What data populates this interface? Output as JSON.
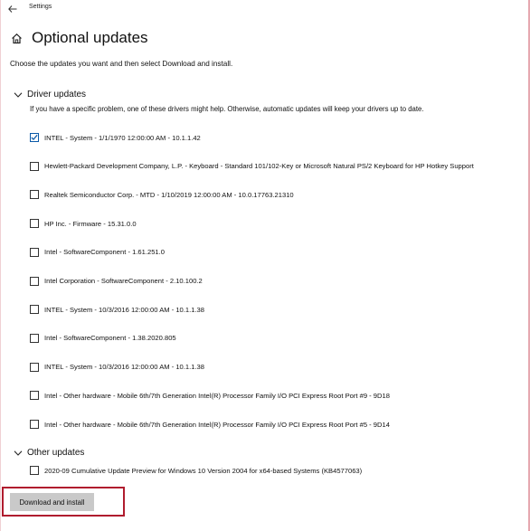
{
  "window": {
    "title": "Settings"
  },
  "header": {
    "title": "Optional updates",
    "subtitle": "Choose the updates you want and then select Download and install."
  },
  "driver_updates": {
    "heading": "Driver updates",
    "help_text": "If you have a specific problem, one of these drivers might help. Otherwise, automatic updates will keep your drivers up to date.",
    "items": [
      {
        "label": "INTEL - System - 1/1/1970 12:00:00 AM - 10.1.1.42",
        "checked": true
      },
      {
        "label": "Hewlett-Packard Development Company, L.P. - Keyboard - Standard 101/102-Key or Microsoft Natural PS/2 Keyboard for HP Hotkey Support",
        "checked": false
      },
      {
        "label": "Realtek Semiconductor Corp. - MTD - 1/10/2019 12:00:00 AM - 10.0.17763.21310",
        "checked": false
      },
      {
        "label": "HP Inc. - Firmware - 15.31.0.0",
        "checked": false
      },
      {
        "label": "Intel - SoftwareComponent - 1.61.251.0",
        "checked": false
      },
      {
        "label": "Intel Corporation - SoftwareComponent - 2.10.100.2",
        "checked": false
      },
      {
        "label": "INTEL - System - 10/3/2016 12:00:00 AM - 10.1.1.38",
        "checked": false
      },
      {
        "label": "Intel - SoftwareComponent - 1.38.2020.805",
        "checked": false
      },
      {
        "label": "INTEL - System - 10/3/2016 12:00:00 AM - 10.1.1.38",
        "checked": false
      },
      {
        "label": "Intel - Other hardware - Mobile 6th/7th Generation Intel(R) Processor Family I/O PCI Express Root Port #9 - 9D18",
        "checked": false
      },
      {
        "label": "Intel - Other hardware - Mobile 6th/7th Generation Intel(R) Processor Family I/O PCI Express Root Port #5 - 9D14",
        "checked": false
      }
    ]
  },
  "other_updates": {
    "heading": "Other updates",
    "items": [
      {
        "label": "2020-09 Cumulative Update Preview for Windows 10 Version 2004 for x64-based Systems (KB4577063)",
        "checked": false
      }
    ]
  },
  "actions": {
    "install_label": "Download and install"
  },
  "colors": {
    "checkmark": "#0b5aa8",
    "button_bg": "#c9c9c9",
    "highlight": "#b01c2e"
  }
}
